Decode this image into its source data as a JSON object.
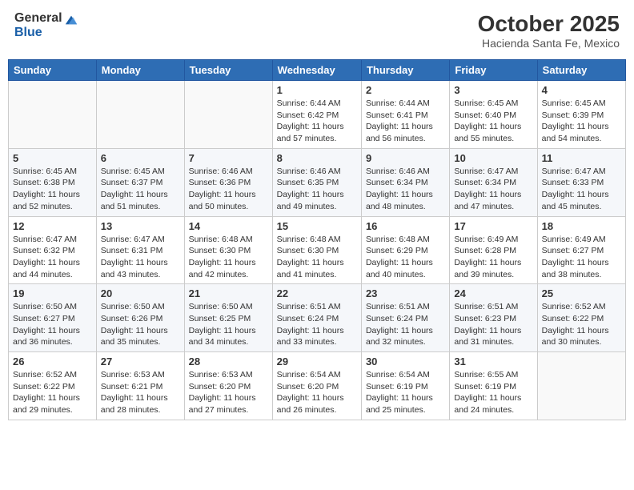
{
  "header": {
    "logo": {
      "general": "General",
      "blue": "Blue"
    },
    "month": "October 2025",
    "location": "Hacienda Santa Fe, Mexico"
  },
  "weekdays": [
    "Sunday",
    "Monday",
    "Tuesday",
    "Wednesday",
    "Thursday",
    "Friday",
    "Saturday"
  ],
  "weeks": [
    [
      {
        "day": "",
        "info": ""
      },
      {
        "day": "",
        "info": ""
      },
      {
        "day": "",
        "info": ""
      },
      {
        "day": "1",
        "info": "Sunrise: 6:44 AM\nSunset: 6:42 PM\nDaylight: 11 hours\nand 57 minutes."
      },
      {
        "day": "2",
        "info": "Sunrise: 6:44 AM\nSunset: 6:41 PM\nDaylight: 11 hours\nand 56 minutes."
      },
      {
        "day": "3",
        "info": "Sunrise: 6:45 AM\nSunset: 6:40 PM\nDaylight: 11 hours\nand 55 minutes."
      },
      {
        "day": "4",
        "info": "Sunrise: 6:45 AM\nSunset: 6:39 PM\nDaylight: 11 hours\nand 54 minutes."
      }
    ],
    [
      {
        "day": "5",
        "info": "Sunrise: 6:45 AM\nSunset: 6:38 PM\nDaylight: 11 hours\nand 52 minutes."
      },
      {
        "day": "6",
        "info": "Sunrise: 6:45 AM\nSunset: 6:37 PM\nDaylight: 11 hours\nand 51 minutes."
      },
      {
        "day": "7",
        "info": "Sunrise: 6:46 AM\nSunset: 6:36 PM\nDaylight: 11 hours\nand 50 minutes."
      },
      {
        "day": "8",
        "info": "Sunrise: 6:46 AM\nSunset: 6:35 PM\nDaylight: 11 hours\nand 49 minutes."
      },
      {
        "day": "9",
        "info": "Sunrise: 6:46 AM\nSunset: 6:34 PM\nDaylight: 11 hours\nand 48 minutes."
      },
      {
        "day": "10",
        "info": "Sunrise: 6:47 AM\nSunset: 6:34 PM\nDaylight: 11 hours\nand 47 minutes."
      },
      {
        "day": "11",
        "info": "Sunrise: 6:47 AM\nSunset: 6:33 PM\nDaylight: 11 hours\nand 45 minutes."
      }
    ],
    [
      {
        "day": "12",
        "info": "Sunrise: 6:47 AM\nSunset: 6:32 PM\nDaylight: 11 hours\nand 44 minutes."
      },
      {
        "day": "13",
        "info": "Sunrise: 6:47 AM\nSunset: 6:31 PM\nDaylight: 11 hours\nand 43 minutes."
      },
      {
        "day": "14",
        "info": "Sunrise: 6:48 AM\nSunset: 6:30 PM\nDaylight: 11 hours\nand 42 minutes."
      },
      {
        "day": "15",
        "info": "Sunrise: 6:48 AM\nSunset: 6:30 PM\nDaylight: 11 hours\nand 41 minutes."
      },
      {
        "day": "16",
        "info": "Sunrise: 6:48 AM\nSunset: 6:29 PM\nDaylight: 11 hours\nand 40 minutes."
      },
      {
        "day": "17",
        "info": "Sunrise: 6:49 AM\nSunset: 6:28 PM\nDaylight: 11 hours\nand 39 minutes."
      },
      {
        "day": "18",
        "info": "Sunrise: 6:49 AM\nSunset: 6:27 PM\nDaylight: 11 hours\nand 38 minutes."
      }
    ],
    [
      {
        "day": "19",
        "info": "Sunrise: 6:50 AM\nSunset: 6:27 PM\nDaylight: 11 hours\nand 36 minutes."
      },
      {
        "day": "20",
        "info": "Sunrise: 6:50 AM\nSunset: 6:26 PM\nDaylight: 11 hours\nand 35 minutes."
      },
      {
        "day": "21",
        "info": "Sunrise: 6:50 AM\nSunset: 6:25 PM\nDaylight: 11 hours\nand 34 minutes."
      },
      {
        "day": "22",
        "info": "Sunrise: 6:51 AM\nSunset: 6:24 PM\nDaylight: 11 hours\nand 33 minutes."
      },
      {
        "day": "23",
        "info": "Sunrise: 6:51 AM\nSunset: 6:24 PM\nDaylight: 11 hours\nand 32 minutes."
      },
      {
        "day": "24",
        "info": "Sunrise: 6:51 AM\nSunset: 6:23 PM\nDaylight: 11 hours\nand 31 minutes."
      },
      {
        "day": "25",
        "info": "Sunrise: 6:52 AM\nSunset: 6:22 PM\nDaylight: 11 hours\nand 30 minutes."
      }
    ],
    [
      {
        "day": "26",
        "info": "Sunrise: 6:52 AM\nSunset: 6:22 PM\nDaylight: 11 hours\nand 29 minutes."
      },
      {
        "day": "27",
        "info": "Sunrise: 6:53 AM\nSunset: 6:21 PM\nDaylight: 11 hours\nand 28 minutes."
      },
      {
        "day": "28",
        "info": "Sunrise: 6:53 AM\nSunset: 6:20 PM\nDaylight: 11 hours\nand 27 minutes."
      },
      {
        "day": "29",
        "info": "Sunrise: 6:54 AM\nSunset: 6:20 PM\nDaylight: 11 hours\nand 26 minutes."
      },
      {
        "day": "30",
        "info": "Sunrise: 6:54 AM\nSunset: 6:19 PM\nDaylight: 11 hours\nand 25 minutes."
      },
      {
        "day": "31",
        "info": "Sunrise: 6:55 AM\nSunset: 6:19 PM\nDaylight: 11 hours\nand 24 minutes."
      },
      {
        "day": "",
        "info": ""
      }
    ]
  ]
}
